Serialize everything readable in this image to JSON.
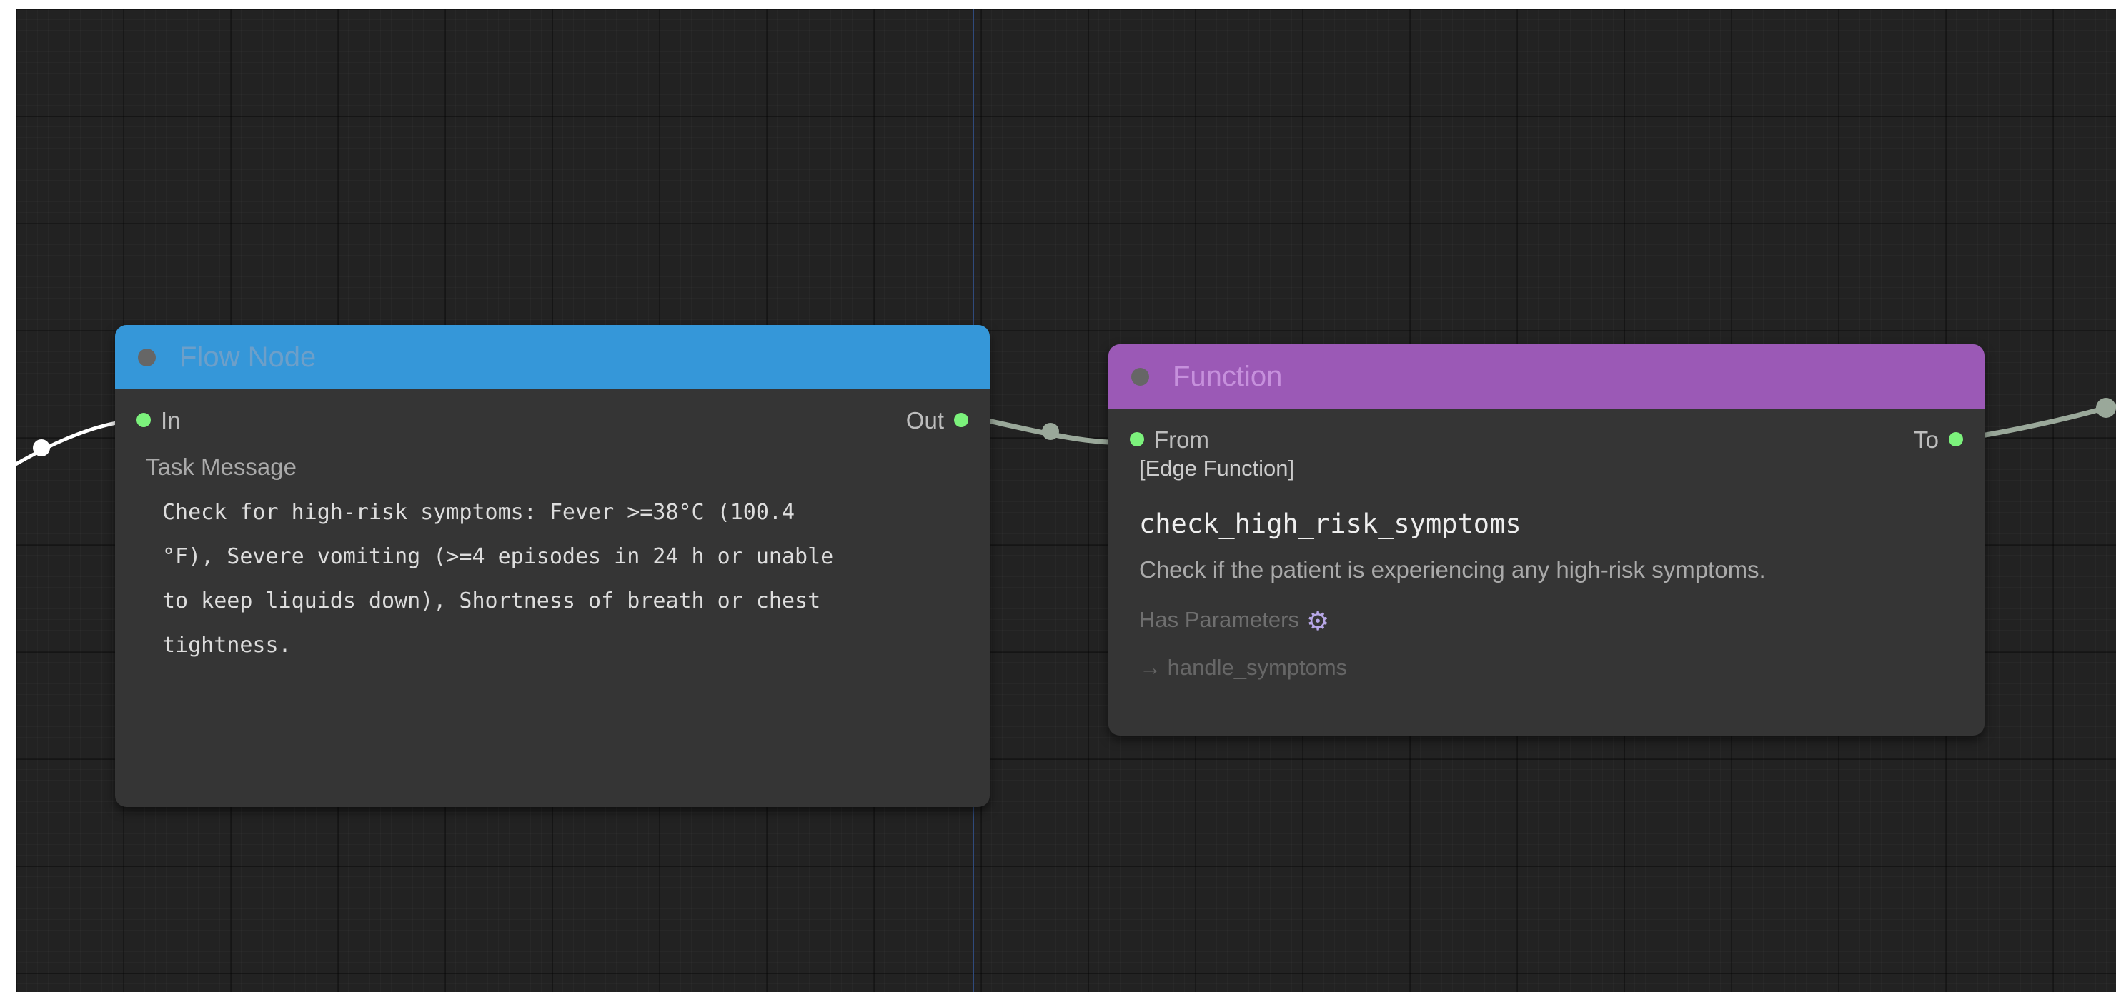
{
  "canvas": {
    "background": "#222222",
    "link_color": "#9aa89a"
  },
  "flow_node": {
    "title": "Flow Node",
    "header_color": "#3597d9",
    "input_label": "In",
    "output_label": "Out",
    "field_label": "Task Message",
    "task_message": "Check for high-risk symptoms: Fever >=38°C (100.4\n°F), Severe vomiting (>=4 episodes in 24 h or unable\nto keep liquids down), Shortness of breath or chest\ntightness."
  },
  "function_node": {
    "title": "Function",
    "header_color": "#9b59b6",
    "input_label": "From",
    "output_label": "To",
    "tag": "[Edge Function]",
    "name": "check_high_risk_symptoms",
    "description": "Check if the patient is experiencing any high-risk symptoms.",
    "params_label": "Has Parameters",
    "params_icon": "gear-icon",
    "target": "→ handle_symptoms"
  }
}
